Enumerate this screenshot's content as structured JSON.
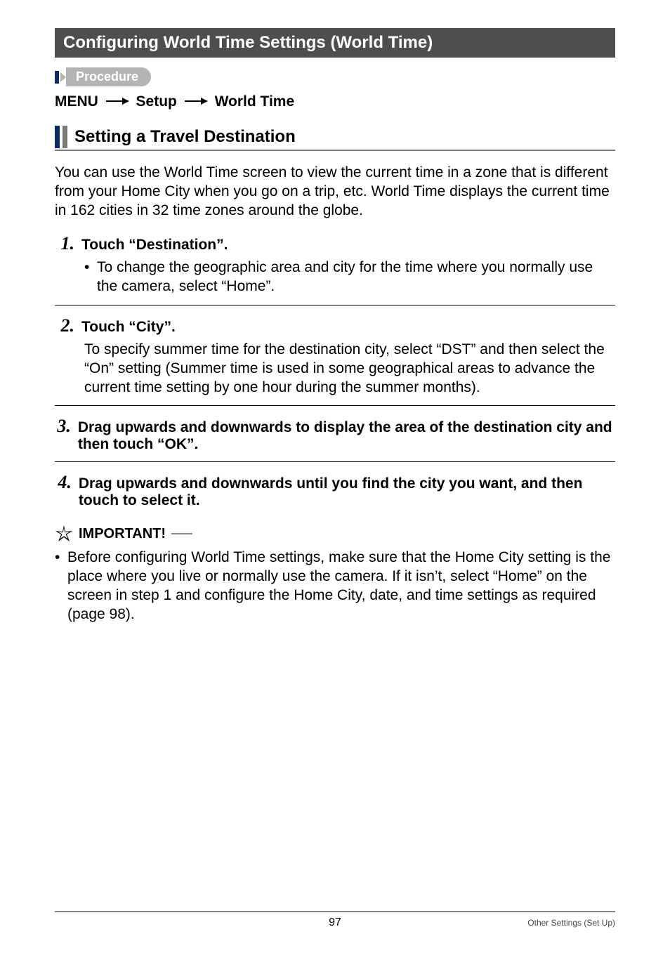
{
  "section": {
    "title": "Configuring World Time Settings (World Time)"
  },
  "procedure": {
    "label": "Procedure"
  },
  "breadcrumb": {
    "a": "MENU",
    "b": "Setup",
    "c": "World Time"
  },
  "subheader": {
    "title": "Setting a Travel Destination"
  },
  "intro": "You can use the World Time screen to view the current time in a zone that is different from your Home City when you go on a trip, etc. World Time displays the current time in 162 cities in 32 time zones around the globe.",
  "steps": {
    "s1": {
      "num": "1.",
      "title": "Touch “Destination”.",
      "bullet": "To change the geographic area and city for the time where you normally use the camera, select “Home”."
    },
    "s2": {
      "num": "2.",
      "title": "Touch “City”.",
      "body": "To specify summer time for the destination city, select “DST” and then select the “On” setting (Summer time is used in some geographical areas to advance the current time setting by one hour during the summer months)."
    },
    "s3": {
      "num": "3.",
      "title": "Drag upwards and downwards to display the area of the destination city and then touch “OK”."
    },
    "s4": {
      "num": "4.",
      "title": "Drag upwards and downwards until you find the city you want, and then touch to select it."
    }
  },
  "important": {
    "label": "IMPORTANT!",
    "body": "Before configuring World Time settings, make sure that the Home City setting is the place where you live or normally use the camera. If it isn’t, select “Home” on the screen in step 1 and configure the Home City, date, and time settings as required (page 98)."
  },
  "footer": {
    "page": "97",
    "section": "Other Settings (Set Up)"
  }
}
